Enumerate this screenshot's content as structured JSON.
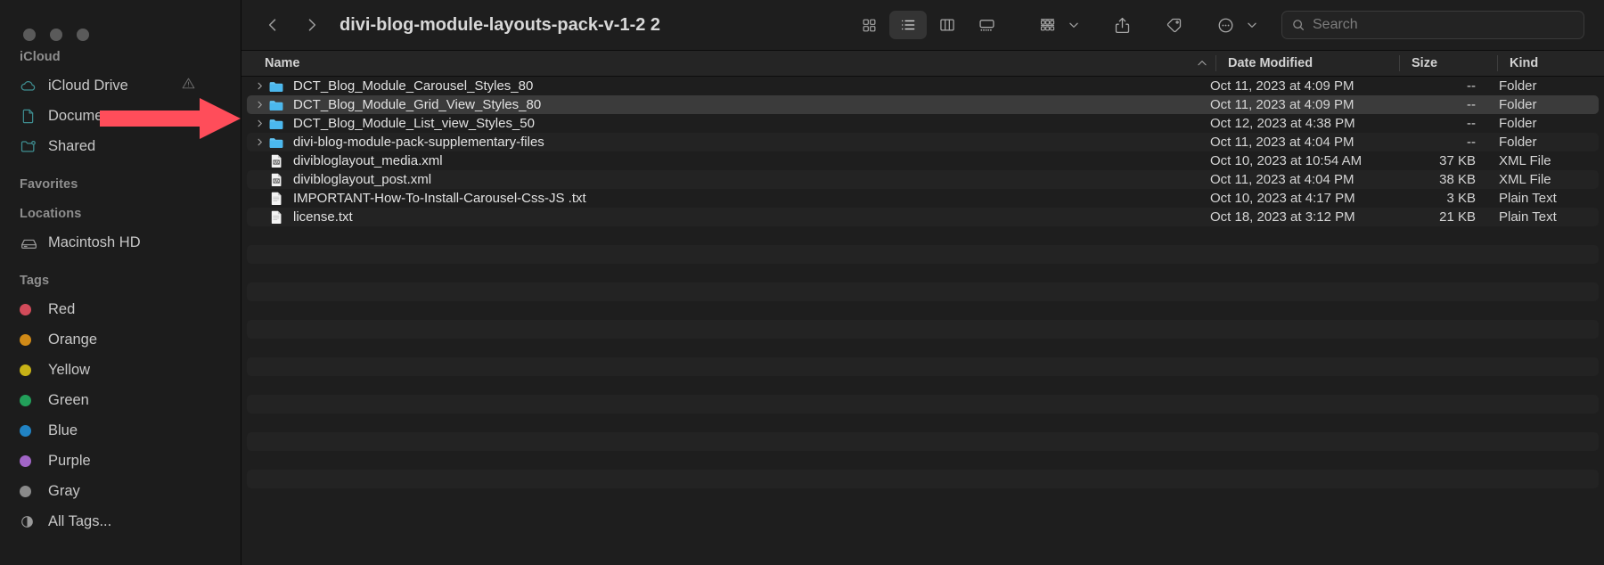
{
  "window": {
    "title": "divi-blog-module-layouts-pack-v-1-2 2",
    "traffic_lights": [
      "close",
      "minimize",
      "zoom"
    ]
  },
  "sidebar": {
    "sections": [
      {
        "title": "iCloud",
        "items": [
          {
            "label": "iCloud Drive",
            "icon": "cloud-icon",
            "badge": "warning-triangle-icon"
          },
          {
            "label": "Documents",
            "icon": "document-icon"
          },
          {
            "label": "Shared",
            "icon": "shared-folder-icon"
          }
        ]
      },
      {
        "title": "Favorites",
        "items": []
      },
      {
        "title": "Locations",
        "items": [
          {
            "label": "Macintosh HD",
            "icon": "harddisk-icon"
          }
        ]
      },
      {
        "title": "Tags",
        "items": [
          {
            "label": "Red",
            "icon": "tag-dot",
            "color": "#d24b5a"
          },
          {
            "label": "Orange",
            "icon": "tag-dot",
            "color": "#d08a17"
          },
          {
            "label": "Yellow",
            "icon": "tag-dot",
            "color": "#c7b216"
          },
          {
            "label": "Green",
            "icon": "tag-dot",
            "color": "#22a05a"
          },
          {
            "label": "Blue",
            "icon": "tag-dot",
            "color": "#2183c4"
          },
          {
            "label": "Purple",
            "icon": "tag-dot",
            "color": "#a165c6"
          },
          {
            "label": "Gray",
            "icon": "tag-dot",
            "color": "#8a8a8a"
          },
          {
            "label": "All Tags...",
            "icon": "all-tags-icon"
          }
        ]
      }
    ]
  },
  "toolbar": {
    "back_label": "Back",
    "forward_label": "Forward",
    "view_modes": [
      {
        "name": "icon-view",
        "label": "as Icons",
        "active": false
      },
      {
        "name": "list-view",
        "label": "as List",
        "active": true
      },
      {
        "name": "column-view",
        "label": "as Columns",
        "active": false
      },
      {
        "name": "gallery-view",
        "label": "as Gallery",
        "active": false
      }
    ],
    "group_by_label": "Group",
    "share_label": "Share",
    "tags_label": "Tags",
    "more_label": "More"
  },
  "search": {
    "placeholder": "Search",
    "value": ""
  },
  "columns": {
    "name": "Name",
    "date_modified": "Date Modified",
    "size": "Size",
    "kind": "Kind",
    "sort_column": "Name",
    "sort_direction": "ascending"
  },
  "files": [
    {
      "name": "DCT_Blog_Module_Carousel_Styles_80",
      "icon": "folder-icon",
      "expandable": true,
      "date_modified": "Oct 11, 2023 at 4:09 PM",
      "size": "--",
      "kind": "Folder",
      "selected": false
    },
    {
      "name": "DCT_Blog_Module_Grid_View_Styles_80",
      "icon": "folder-icon",
      "expandable": true,
      "date_modified": "Oct 11, 2023 at 4:09 PM",
      "size": "--",
      "kind": "Folder",
      "selected": true
    },
    {
      "name": "DCT_Blog_Module_List_view_Styles_50",
      "icon": "folder-icon",
      "expandable": true,
      "date_modified": "Oct 12, 2023 at 4:38 PM",
      "size": "--",
      "kind": "Folder",
      "selected": false
    },
    {
      "name": "divi-blog-module-pack-supplementary-files",
      "icon": "folder-icon",
      "expandable": true,
      "date_modified": "Oct 11, 2023 at 4:04 PM",
      "size": "--",
      "kind": "Folder",
      "selected": false
    },
    {
      "name": "divibloglayout_media.xml",
      "icon": "xml-file-icon",
      "expandable": false,
      "date_modified": "Oct 10, 2023 at 10:54 AM",
      "size": "37 KB",
      "kind": "XML File",
      "selected": false
    },
    {
      "name": "divibloglayout_post.xml",
      "icon": "xml-file-icon",
      "expandable": false,
      "date_modified": "Oct 11, 2023 at 4:04 PM",
      "size": "38 KB",
      "kind": "XML File",
      "selected": false
    },
    {
      "name": "IMPORTANT-How-To-Install-Carousel-Css-JS .txt",
      "icon": "text-file-icon",
      "expandable": false,
      "date_modified": "Oct 10, 2023 at 4:17 PM",
      "size": "3 KB",
      "kind": "Plain Text",
      "selected": false
    },
    {
      "name": "license.txt",
      "icon": "text-file-icon",
      "expandable": false,
      "date_modified": "Oct 18, 2023 at 3:12 PM",
      "size": "21 KB",
      "kind": "Plain Text",
      "selected": false
    }
  ],
  "annotation": {
    "arrow": {
      "name": "red-arrow-pointer",
      "color": "#ff4d5a",
      "points_at": "DCT_Blog_Module_Grid_View_Styles_80"
    }
  },
  "empty_rows": 14
}
